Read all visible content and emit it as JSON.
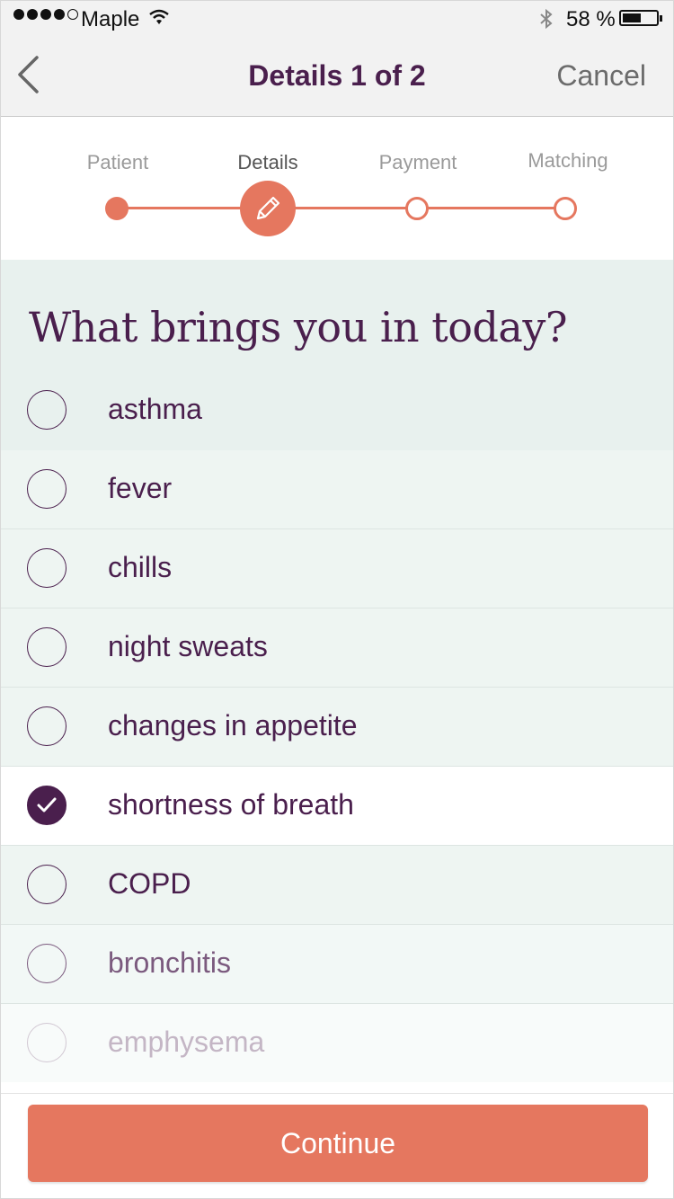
{
  "status_bar": {
    "carrier": "Maple",
    "battery_percent": "58 %",
    "battery_level": 0.58
  },
  "nav": {
    "title": "Details 1 of 2",
    "cancel_label": "Cancel"
  },
  "stepper": {
    "steps": [
      {
        "label": "Patient",
        "state": "done"
      },
      {
        "label": "Details",
        "state": "active"
      },
      {
        "label": "Payment",
        "state": "todo"
      },
      {
        "label": "Matching",
        "state": "todo"
      }
    ]
  },
  "question": "What brings you in today?",
  "options": [
    {
      "label": "asthma",
      "selected": false
    },
    {
      "label": "fever",
      "selected": false
    },
    {
      "label": "chills",
      "selected": false
    },
    {
      "label": "night sweats",
      "selected": false
    },
    {
      "label": "changes in appetite",
      "selected": false
    },
    {
      "label": "shortness of breath",
      "selected": true
    },
    {
      "label": "COPD",
      "selected": false
    },
    {
      "label": "bronchitis",
      "selected": false
    },
    {
      "label": "emphysema",
      "selected": false
    }
  ],
  "continue_label": "Continue",
  "colors": {
    "accent": "#e5775f",
    "primary_text": "#4a1f4d",
    "list_background": "#e8f1ee"
  }
}
